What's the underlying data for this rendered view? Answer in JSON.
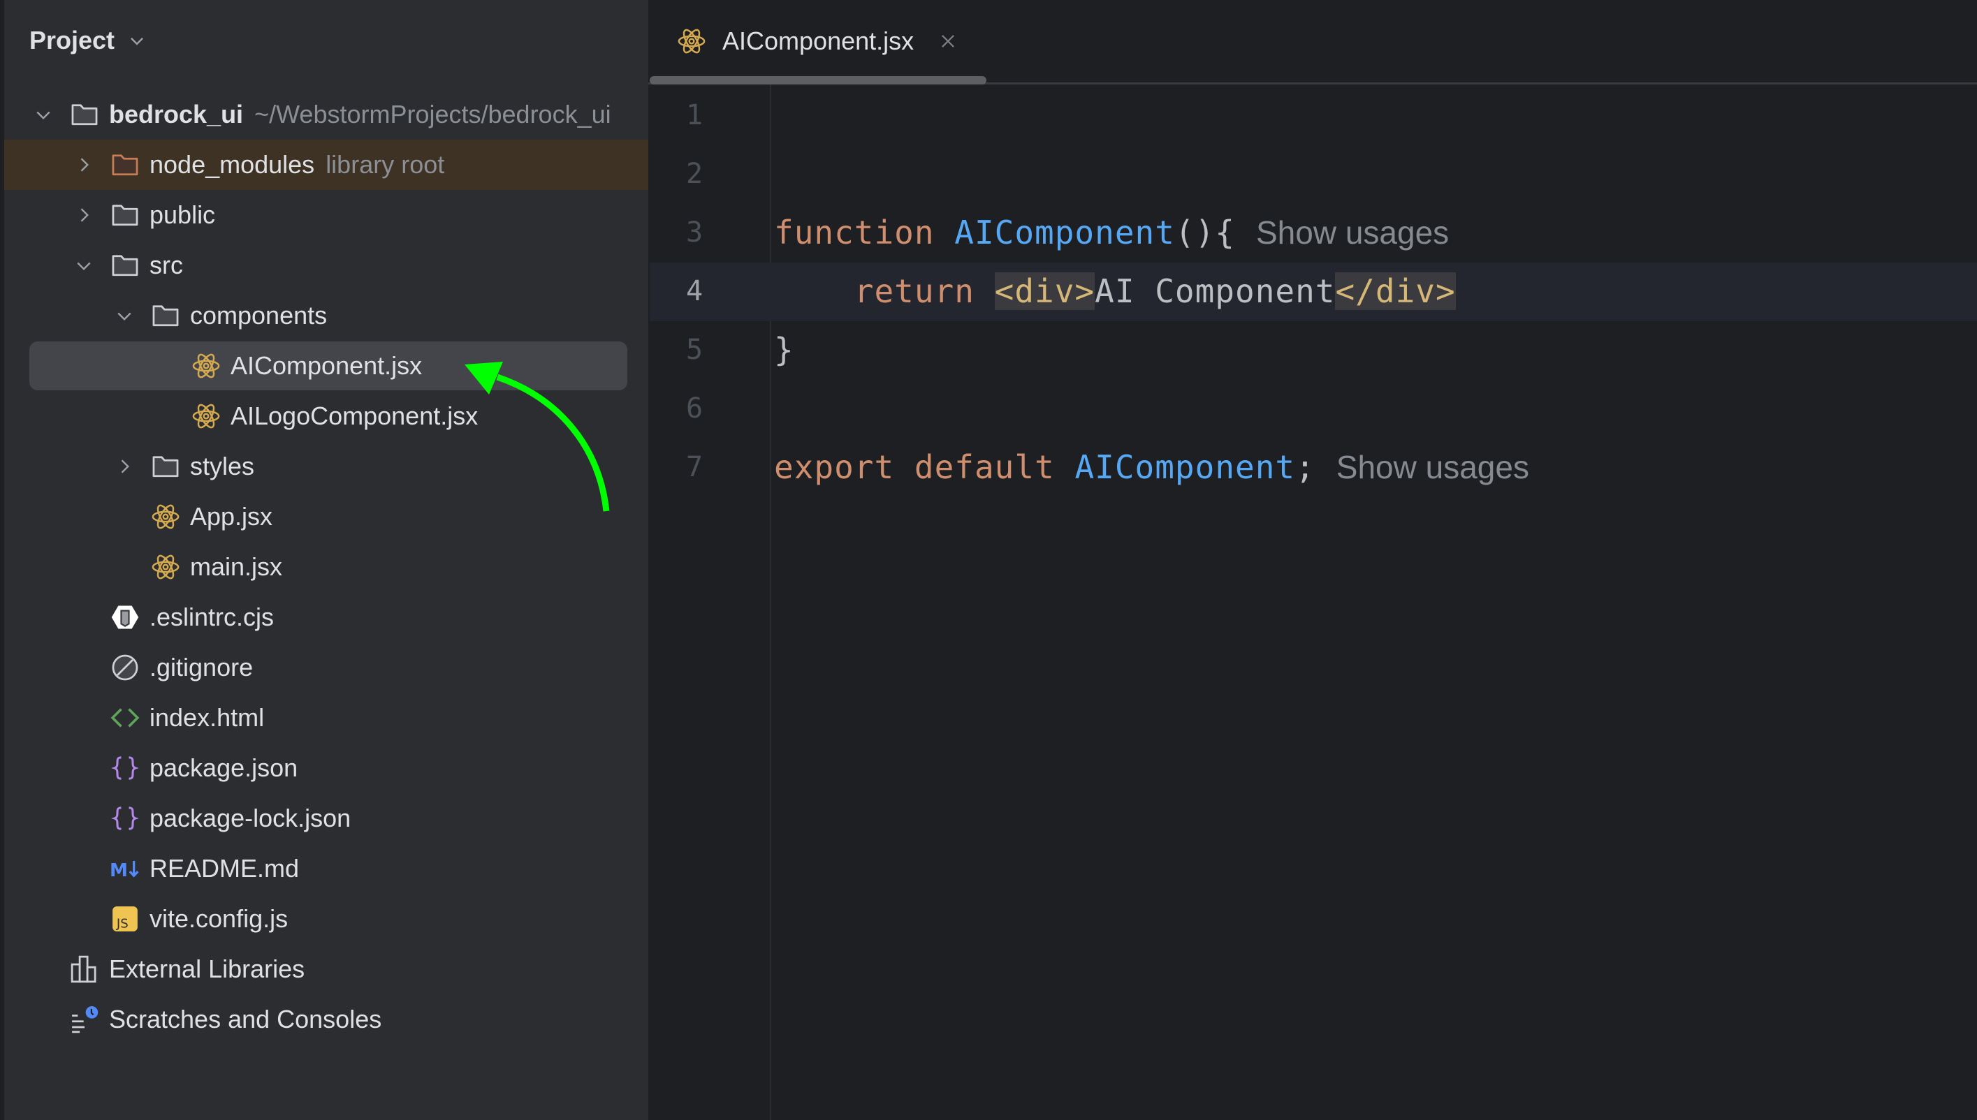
{
  "sidebar": {
    "title": "Project",
    "tree": [
      {
        "label": "bedrock_ui",
        "hint": "~/WebstormProjects/bedrock_ui",
        "icon": "folder-icon",
        "toggle": "expanded",
        "depth": 0,
        "bold": true
      },
      {
        "label": "node_modules",
        "hint": "library root",
        "icon": "library-folder-icon",
        "toggle": "collapsed",
        "depth": 1
      },
      {
        "label": "public",
        "icon": "folder-icon",
        "toggle": "collapsed",
        "depth": 1
      },
      {
        "label": "src",
        "icon": "folder-icon",
        "toggle": "expanded",
        "depth": 1
      },
      {
        "label": "components",
        "icon": "folder-icon",
        "toggle": "expanded",
        "depth": 2
      },
      {
        "label": "AIComponent.jsx",
        "icon": "react-icon",
        "depth": 3,
        "selected": true
      },
      {
        "label": "AILogoComponent.jsx",
        "icon": "react-icon",
        "depth": 3
      },
      {
        "label": "styles",
        "icon": "folder-icon",
        "toggle": "collapsed",
        "depth": 2
      },
      {
        "label": "App.jsx",
        "icon": "react-icon",
        "depth": 2
      },
      {
        "label": "main.jsx",
        "icon": "react-icon",
        "depth": 2
      },
      {
        "label": ".eslintrc.cjs",
        "icon": "eslint-icon",
        "depth": 1
      },
      {
        "label": ".gitignore",
        "icon": "ignore-icon",
        "depth": 1
      },
      {
        "label": "index.html",
        "icon": "html-icon",
        "depth": 1
      },
      {
        "label": "package.json",
        "icon": "json-icon",
        "depth": 1
      },
      {
        "label": "package-lock.json",
        "icon": "json-icon",
        "depth": 1
      },
      {
        "label": "README.md",
        "icon": "markdown-icon",
        "depth": 1
      },
      {
        "label": "vite.config.js",
        "icon": "javascript-icon",
        "depth": 1
      },
      {
        "label": "External Libraries",
        "icon": "external-libraries-icon",
        "depth": 0,
        "notoggle": true
      },
      {
        "label": "Scratches and Consoles",
        "icon": "scratches-icon",
        "depth": 0,
        "notoggle": true
      }
    ]
  },
  "editor": {
    "tab": {
      "label": "AIComponent.jsx",
      "icon": "react-icon"
    },
    "current_line": 4,
    "lines": [
      {
        "n": "1",
        "tokens": []
      },
      {
        "n": "2",
        "tokens": []
      },
      {
        "n": "3",
        "tokens": [
          {
            "t": "function",
            "c": "kw"
          },
          {
            "t": " ",
            "c": "txt"
          },
          {
            "t": "AIComponent",
            "c": "fn"
          },
          {
            "t": "(){",
            "c": "txt"
          }
        ],
        "inlay": "Show usages"
      },
      {
        "n": "4",
        "tokens": [
          {
            "t": "    ",
            "c": "txt"
          },
          {
            "t": "return",
            "c": "kw"
          },
          {
            "t": " ",
            "c": "txt"
          },
          {
            "t": "<div>",
            "c": "tag"
          },
          {
            "t": "AI Component",
            "c": "txt"
          },
          {
            "t": "</div>",
            "c": "tag"
          }
        ]
      },
      {
        "n": "5",
        "tokens": [
          {
            "t": "}",
            "c": "txt"
          }
        ]
      },
      {
        "n": "6",
        "tokens": []
      },
      {
        "n": "7",
        "tokens": [
          {
            "t": "export",
            "c": "kw"
          },
          {
            "t": " ",
            "c": "txt"
          },
          {
            "t": "default",
            "c": "kw"
          },
          {
            "t": " ",
            "c": "txt"
          },
          {
            "t": "AIComponent",
            "c": "fn"
          },
          {
            "t": ";",
            "c": "txt"
          }
        ],
        "inlay": "Show usages"
      }
    ]
  },
  "annotation": {
    "type": "arrow",
    "color": "#00ff00",
    "points_to": "AIComponent.jsx"
  },
  "colors": {
    "keyword": "#cf8e6d",
    "function": "#56a8f5",
    "tag": "#d5b778",
    "react_icon": "#d6ab4f",
    "json_icon": "#b589ec",
    "html_icon": "#5fa55a",
    "markdown_icon": "#548af7",
    "js_icon": "#f0c451",
    "library_root_bg": "#3d3223"
  }
}
